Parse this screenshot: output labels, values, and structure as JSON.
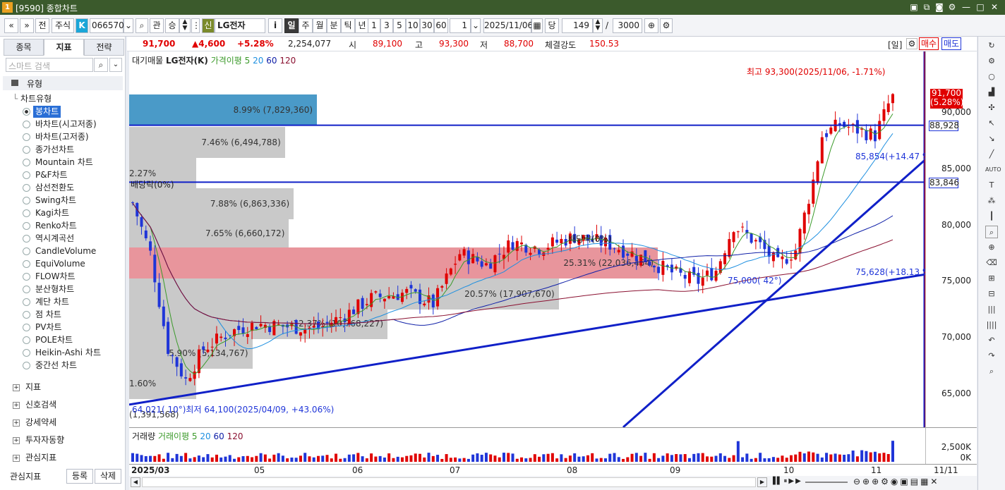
{
  "window": {
    "title": "[9590] 종합차트",
    "colors": {
      "titlebar": "#3b5a2c"
    }
  },
  "toolbar": {
    "nav_prev": "«",
    "nav_down": "»",
    "jeon": "전",
    "market": "주식",
    "code": "066570",
    "gwan": "관",
    "seung": "승",
    "credit_badge": "신",
    "stock_name": "LG전자",
    "info": "i",
    "periods": [
      "일",
      "주",
      "월",
      "분",
      "틱",
      "년"
    ],
    "minute_options": [
      "1",
      "3",
      "5",
      "10",
      "30",
      "60"
    ],
    "interval": "1",
    "date": "2025/11/06",
    "dang": "당",
    "count": "149",
    "slash": "/",
    "max_count": "3000"
  },
  "left": {
    "tabs": [
      "종목",
      "지표",
      "전략"
    ],
    "search_placeholder": "스마트 검색",
    "group_type": "유형",
    "chart_type_header": "차트유형",
    "chart_types": [
      "봉차트",
      "바차트(시고저종)",
      "바차트(고저종)",
      "종가선차트",
      "Mountain 차트",
      "P&F차트",
      "삼선전환도",
      "Swing차트",
      "Kagi차트",
      "Renko차트",
      "역시계곡선",
      "CandleVolume",
      "EquiVolume",
      "FLOW차트",
      "분산형차트",
      "계단 차트",
      "점 차트",
      "PV차트",
      "POLE차트",
      "Heikin-Ashi 차트",
      "중간선 차트"
    ],
    "selected_type": "봉차트",
    "sections": [
      "지표",
      "신호검색",
      "강세약세",
      "투자자동향",
      "관심지표"
    ],
    "footer_label": "관심지표",
    "register": "등록",
    "delete": "삭제"
  },
  "quote": {
    "price": "91,700",
    "change": "▲4,600",
    "change_pct": "+5.28%",
    "volume": "2,254,077",
    "open_label": "시",
    "open": "89,100",
    "high_label": "고",
    "high": "93,300",
    "low_label": "저",
    "low": "88,700",
    "strength_label": "체결강도",
    "strength": "150.53",
    "day_tag": "[일]",
    "buy": "매수",
    "sell": "매도"
  },
  "legend": {
    "title": "대기매물",
    "stock": "LG전자(K)",
    "ma_label": "가격이평 5",
    "ma20": "20",
    "ma60": "60",
    "ma120": "120"
  },
  "vol_legend": {
    "title": "거래량",
    "ma_label": "거래이평 5",
    "ma20": "20",
    "ma60": "60",
    "ma120": "120"
  },
  "annotations": {
    "high": "최고 93,300(2025/11/06, -1.71%)",
    "low": "64,021( 10°)최저 64,100(2025/04/09, +43.06%)",
    "dividend1": "배당락(0%)",
    "dividend2": "배당락(0%)",
    "trend1": "85,854(+14.47 %)",
    "trend2": "75,000( 42°)",
    "trend3": "75,628(+18.13 %)"
  },
  "volume_profile": [
    {
      "pct_label": "8.99% (7,829,360)",
      "pct": 8.99,
      "hi": true
    },
    {
      "pct_label": "7.46% (6,494,788)",
      "pct": 7.46
    },
    {
      "pct_label": "2.27% (1,973,296)",
      "pct": 2.27
    },
    {
      "pct_label": "7.88% (6,863,336)",
      "pct": 7.88
    },
    {
      "pct_label": "7.65% (6,660,172)",
      "pct": 7.65
    },
    {
      "pct_label": "25.31% (22,036,454)",
      "pct": 25.31,
      "hi2": true
    },
    {
      "pct_label": "20.57% (17,907,670)",
      "pct": 20.57
    },
    {
      "pct_label": "12.37% (10,768,227)",
      "pct": 12.37
    },
    {
      "pct_label": "5.90% (5,134,767)",
      "pct": 5.9
    },
    {
      "pct_label": "1.60% (1,391,568)",
      "pct": 1.6
    }
  ],
  "y_axis": {
    "ticks": [
      "90,000",
      "85,000",
      "80,000",
      "75,000",
      "70,000",
      "65,000"
    ],
    "price_tag": "91,700",
    "price_tag_pct": "(5.28%)",
    "line1": "88,928",
    "line2": "83,846",
    "vol_ticks": [
      "2,500K",
      "0K"
    ]
  },
  "x_axis": {
    "labels": [
      "2025/03",
      "05",
      "06",
      "07",
      "08",
      "09",
      "10",
      "11"
    ],
    "end_label": "11/11"
  },
  "chart_data": {
    "type": "candlestick",
    "ylim": [
      62000,
      95500
    ],
    "high": 93300,
    "low": 64100,
    "last": 91700,
    "colors": {
      "up": "#e00000",
      "down": "#1f35d8",
      "ma5": "#3b9a2a",
      "ma20": "#1d8fe0",
      "ma60": "#1020a8",
      "ma120": "#8a1030"
    }
  }
}
